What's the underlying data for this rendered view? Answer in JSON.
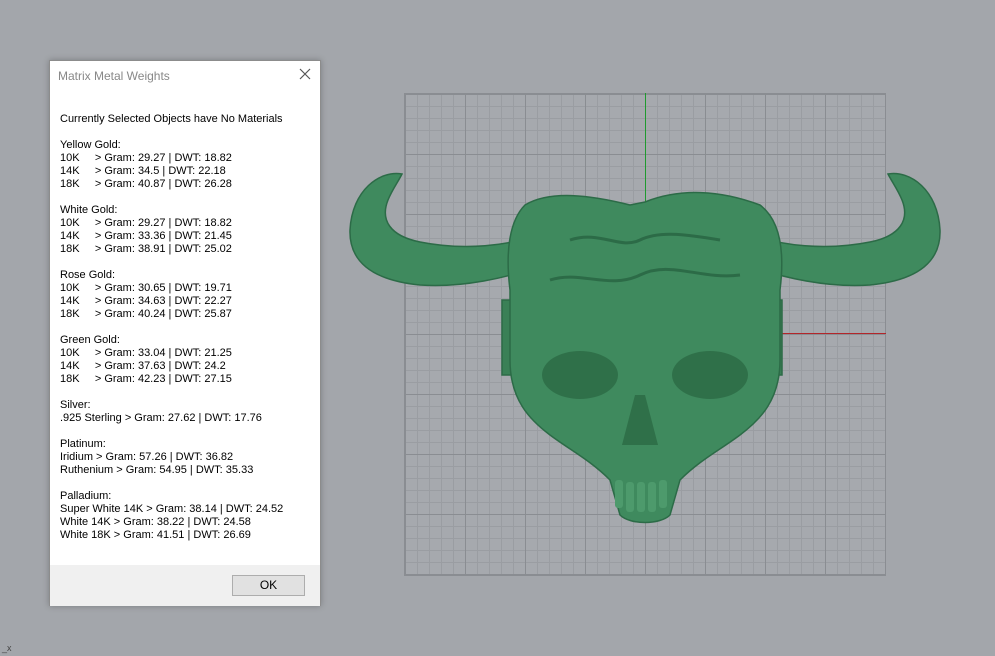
{
  "dialog": {
    "title": "Matrix Metal Weights",
    "header": "Currently Selected Objects have No Materials",
    "ok_label": "OK",
    "groups": [
      {
        "heading": "Yellow Gold:",
        "rows": [
          "10K     > Gram: 29.27 | DWT: 18.82",
          "14K     > Gram: 34.5 | DWT: 22.18",
          "18K     > Gram: 40.87 | DWT: 26.28"
        ]
      },
      {
        "heading": "White Gold:",
        "rows": [
          "10K     > Gram: 29.27 | DWT: 18.82",
          "14K     > Gram: 33.36 | DWT: 21.45",
          "18K     > Gram: 38.91 | DWT: 25.02"
        ]
      },
      {
        "heading": "Rose Gold:",
        "rows": [
          "10K     > Gram: 30.65 | DWT: 19.71",
          "14K     > Gram: 34.63 | DWT: 22.27",
          "18K     > Gram: 40.24 | DWT: 25.87"
        ]
      },
      {
        "heading": "Green Gold:",
        "rows": [
          "10K     > Gram: 33.04 | DWT: 21.25",
          "14K     > Gram: 37.63 | DWT: 24.2",
          "18K     > Gram: 42.23 | DWT: 27.15"
        ]
      },
      {
        "heading": "Silver:",
        "rows": [
          ".925 Sterling > Gram: 27.62 | DWT: 17.76"
        ]
      },
      {
        "heading": "Platinum:",
        "rows": [
          "Iridium > Gram: 57.26 | DWT: 36.82",
          "Ruthenium > Gram: 54.95 | DWT: 35.33"
        ]
      },
      {
        "heading": "Palladium:",
        "rows": [
          "Super White 14K > Gram: 38.14 | DWT: 24.52",
          "White 14K > Gram: 38.22 | DWT: 24.58",
          "White 18K > Gram: 41.51 | DWT: 26.69"
        ]
      }
    ]
  },
  "viewport": {
    "corner_label": "_x",
    "model_color": "#3f8a5e",
    "axis_y_color": "#1f9a2f",
    "axis_x_color": "#b3262a"
  }
}
